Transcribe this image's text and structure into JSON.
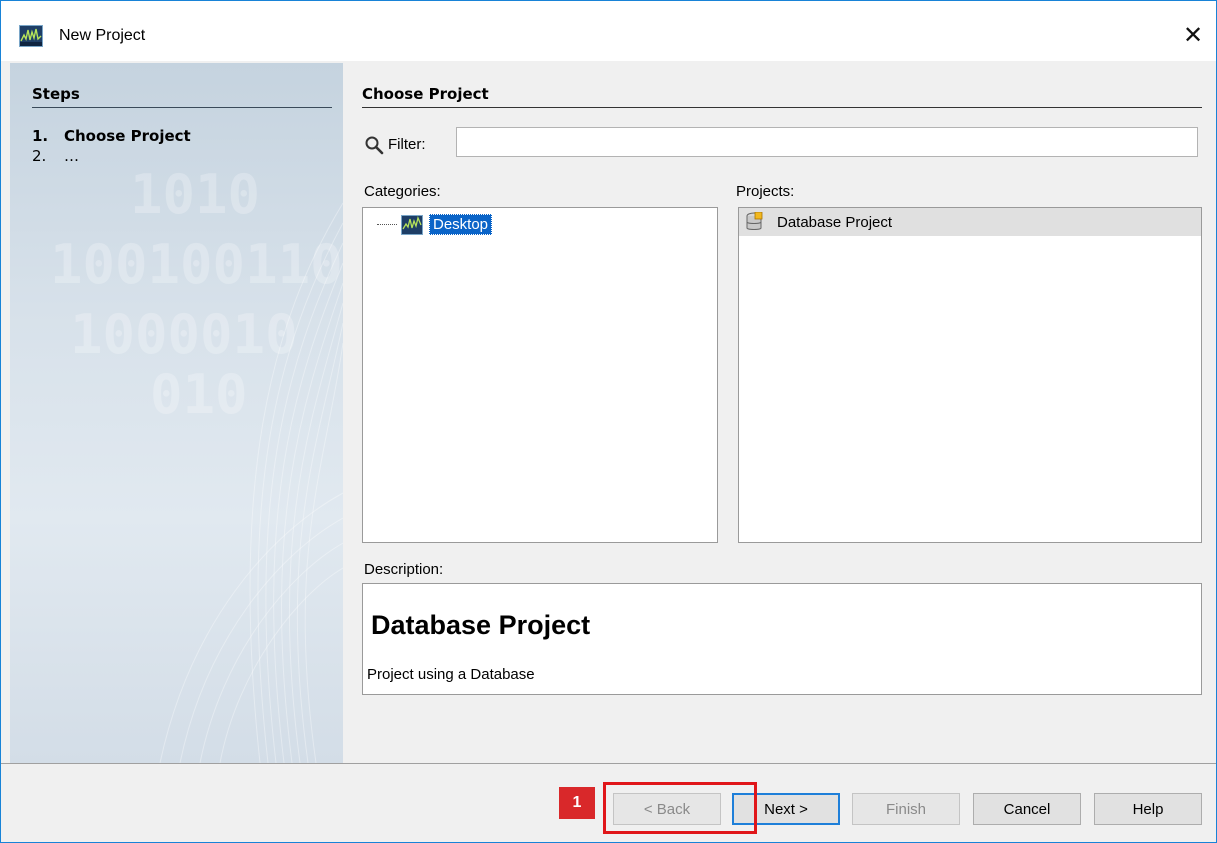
{
  "window": {
    "title": "New Project",
    "close_glyph": "✕"
  },
  "steps": {
    "header": "Steps",
    "items": [
      {
        "num": "1.",
        "label": "Choose Project"
      },
      {
        "num": "2.",
        "label": "…"
      }
    ]
  },
  "content": {
    "title": "Choose Project",
    "filter_label": "Filter:",
    "filter_value": "",
    "categories_label": "Categories:",
    "categories": [
      {
        "label": "Desktop",
        "selected": true
      }
    ],
    "projects_label": "Projects:",
    "projects": [
      {
        "label": "Database Project",
        "selected": true
      }
    ],
    "description_label": "Description:",
    "description": {
      "title": "Database Project",
      "text": "Project using a Database"
    }
  },
  "buttons": {
    "back": "< Back",
    "next": "Next >",
    "finish": "Finish",
    "cancel": "Cancel",
    "help": "Help"
  },
  "annotation": {
    "badge": "1",
    "color": "#e0161a"
  },
  "colors": {
    "accent": "#1883d7",
    "selection": "#0a64c8"
  }
}
